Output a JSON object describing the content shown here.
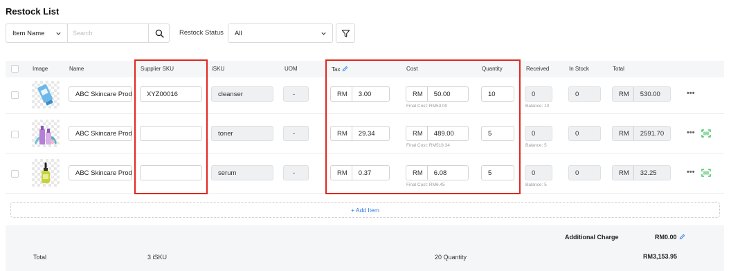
{
  "page": {
    "title": "Restock List"
  },
  "filters": {
    "field_select": "Item Name",
    "search_placeholder": "Search",
    "status_label": "Restock Status",
    "status_value": "All"
  },
  "columns": {
    "image": "Image",
    "name": "Name",
    "supplier_sku": "Supplier SKU",
    "isku": "iSKU",
    "uom": "UOM",
    "tax": "Tax",
    "cost": "Cost",
    "quantity": "Quantity",
    "received": "Received",
    "in_stock": "In Stock",
    "total": "Total"
  },
  "currency": "RM",
  "rows": [
    {
      "image": "cleanser-tube",
      "name": "ABC Skincare Prod",
      "supplier_sku": "XYZ00016",
      "isku": "cleanser",
      "uom": "-",
      "tax": "3.00",
      "cost": "50.00",
      "final_cost": "Final Cost: RM53.00",
      "quantity": "10",
      "received": "0",
      "balance": "Balance: 10",
      "in_stock": "0",
      "total": "530.00",
      "scan_icon": false
    },
    {
      "image": "toner-bottles",
      "name": "ABC Skincare Prod",
      "supplier_sku": "",
      "isku": "toner",
      "uom": "-",
      "tax": "29.34",
      "cost": "489.00",
      "final_cost": "Final Cost: RM518.34",
      "quantity": "5",
      "received": "0",
      "balance": "Balance: 5",
      "in_stock": "0",
      "total": "2591.70",
      "scan_icon": true
    },
    {
      "image": "serum-dropper",
      "name": "ABC Skincare Prod",
      "supplier_sku": "",
      "isku": "serum",
      "uom": "-",
      "tax": "0.37",
      "cost": "6.08",
      "final_cost": "Final Cost: RM6.45",
      "quantity": "5",
      "received": "0",
      "balance": "Balance: 5",
      "in_stock": "0",
      "total": "32.25",
      "scan_icon": true
    }
  ],
  "add_item": "+ Add Item",
  "footer": {
    "additional_charge_label": "Additional Charge",
    "additional_charge_value": "RM0.00",
    "total_label": "Total",
    "isku_count": "3 iSKU",
    "quantity_total": "20 Quantity",
    "grand_total": "RM3,153.95"
  },
  "colors": {
    "accent": "#2f7ce0",
    "highlight": "#e2261e",
    "scan_green": "#2db84d"
  }
}
